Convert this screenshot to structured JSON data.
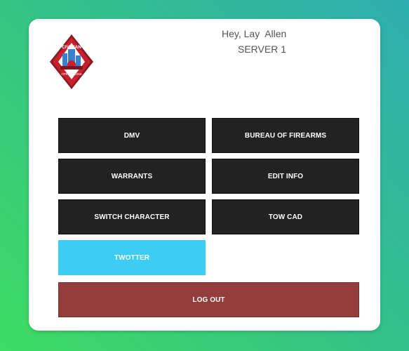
{
  "header": {
    "greeting": "Hey, Lay  Allen",
    "server": "SERVER 1",
    "logo_text_top": "CIVILIAN",
    "logo_text_bottom": "OPERATIONS"
  },
  "buttons": {
    "dmv": "DMV",
    "firearms": "BUREAU OF FIREARMS",
    "warrants": "WARRANTS",
    "edit_info": "EDIT INFO",
    "switch_character": "SWITCH CHARACTER",
    "tow_cad": "TOW CAD",
    "twotter": "TWOTTER",
    "logout": "LOG OUT"
  },
  "colors": {
    "dark_button": "#222222",
    "twotter_button": "#3ccdf5",
    "logout_button": "#943d3d",
    "logo_red": "#c8202f"
  }
}
